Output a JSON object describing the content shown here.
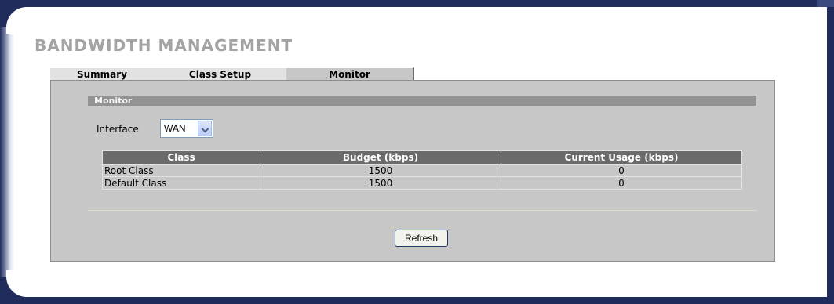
{
  "page": {
    "title": "BANDWIDTH MANAGEMENT"
  },
  "tabs": [
    {
      "label": "Summary",
      "active": false
    },
    {
      "label": "Class Setup",
      "active": false
    },
    {
      "label": "Monitor",
      "active": true
    }
  ],
  "section": {
    "header": "Monitor"
  },
  "interface": {
    "label": "Interface",
    "selected": "WAN"
  },
  "table": {
    "headers": [
      "Class",
      "Budget (kbps)",
      "Current Usage (kbps)"
    ],
    "rows": [
      {
        "class": "Root Class",
        "budget": "1500",
        "usage": "0"
      },
      {
        "class": "Default Class",
        "budget": "1500",
        "usage": "0"
      }
    ]
  },
  "actions": {
    "refresh_label": "Refresh"
  },
  "colors": {
    "frame": "#1f2c5c",
    "panel": "#c7c7c7",
    "table_header": "#6b6b6b"
  },
  "icons": {
    "dropdown": "chevron-down-icon"
  }
}
